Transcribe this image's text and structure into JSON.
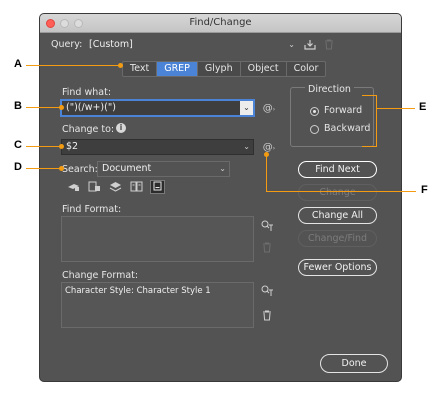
{
  "window": {
    "title": "Find/Change"
  },
  "query": {
    "label": "Query:",
    "value": "[Custom]"
  },
  "tabs": [
    {
      "label": "Text"
    },
    {
      "label": "GREP",
      "active": true
    },
    {
      "label": "Glyph"
    },
    {
      "label": "Object"
    },
    {
      "label": "Color"
    }
  ],
  "find_what": {
    "label": "Find what:",
    "value": "(\")(/w+)(\")"
  },
  "change_to": {
    "label": "Change to:",
    "value": "$2"
  },
  "search": {
    "label": "Search:",
    "value": "Document"
  },
  "find_format": {
    "label": "Find Format:",
    "value": ""
  },
  "change_format": {
    "label": "Change Format:",
    "value": "Character Style: Character Style 1"
  },
  "direction": {
    "label": "Direction",
    "options": [
      {
        "label": "Forward",
        "selected": true
      },
      {
        "label": "Backward",
        "selected": false
      }
    ]
  },
  "buttons": {
    "find_next": "Find Next",
    "change": "Change",
    "change_all": "Change All",
    "change_find": "Change/Find",
    "fewer_options": "Fewer Options",
    "done": "Done"
  },
  "callouts": {
    "a": "A",
    "b": "B",
    "c": "C",
    "d": "D",
    "e": "E",
    "f": "F"
  },
  "icons": {
    "save_query": "save-query-icon",
    "delete_query": "trash-icon",
    "special_chars": "at-sign-icon",
    "info": "info-icon",
    "format_picker": "format-picker-icon"
  },
  "colors": {
    "accent": "#4b84d6",
    "callout": "#f39c12",
    "window_bg": "#535353"
  }
}
